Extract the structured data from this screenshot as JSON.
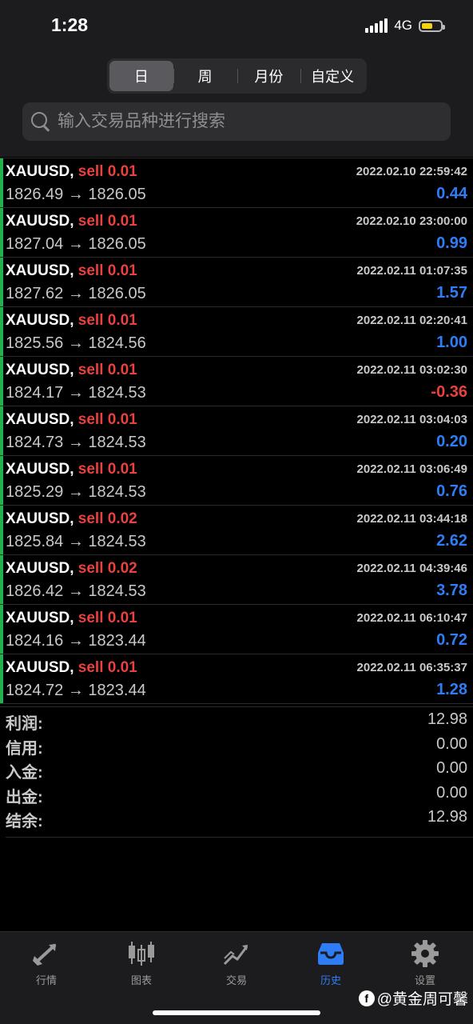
{
  "status_bar": {
    "time": "1:28",
    "network": "4G"
  },
  "period_tabs": [
    {
      "label": "日",
      "active": true
    },
    {
      "label": "周",
      "active": false
    },
    {
      "label": "月份",
      "active": false
    },
    {
      "label": "自定义",
      "active": false
    }
  ],
  "search": {
    "placeholder": "输入交易品种进行搜索"
  },
  "trades": [
    {
      "symbol": "XAUUSD,",
      "action": "sell 0.01",
      "time": "2022.02.10 22:59:42",
      "prices": "1826.49 → 1826.05",
      "profit": "0.44",
      "sign": "pos"
    },
    {
      "symbol": "XAUUSD,",
      "action": "sell 0.01",
      "time": "2022.02.10 23:00:00",
      "prices": "1827.04 → 1826.05",
      "profit": "0.99",
      "sign": "pos"
    },
    {
      "symbol": "XAUUSD,",
      "action": "sell 0.01",
      "time": "2022.02.11 01:07:35",
      "prices": "1827.62 → 1826.05",
      "profit": "1.57",
      "sign": "pos"
    },
    {
      "symbol": "XAUUSD,",
      "action": "sell 0.01",
      "time": "2022.02.11 02:20:41",
      "prices": "1825.56 → 1824.56",
      "profit": "1.00",
      "sign": "pos"
    },
    {
      "symbol": "XAUUSD,",
      "action": "sell 0.01",
      "time": "2022.02.11 03:02:30",
      "prices": "1824.17 → 1824.53",
      "profit": "-0.36",
      "sign": "neg"
    },
    {
      "symbol": "XAUUSD,",
      "action": "sell 0.01",
      "time": "2022.02.11 03:04:03",
      "prices": "1824.73 → 1824.53",
      "profit": "0.20",
      "sign": "pos"
    },
    {
      "symbol": "XAUUSD,",
      "action": "sell 0.01",
      "time": "2022.02.11 03:06:49",
      "prices": "1825.29 → 1824.53",
      "profit": "0.76",
      "sign": "pos"
    },
    {
      "symbol": "XAUUSD,",
      "action": "sell 0.02",
      "time": "2022.02.11 03:44:18",
      "prices": "1825.84 → 1824.53",
      "profit": "2.62",
      "sign": "pos"
    },
    {
      "symbol": "XAUUSD,",
      "action": "sell 0.02",
      "time": "2022.02.11 04:39:46",
      "prices": "1826.42 → 1824.53",
      "profit": "3.78",
      "sign": "pos"
    },
    {
      "symbol": "XAUUSD,",
      "action": "sell 0.01",
      "time": "2022.02.11 06:10:47",
      "prices": "1824.16 → 1823.44",
      "profit": "0.72",
      "sign": "pos"
    },
    {
      "symbol": "XAUUSD,",
      "action": "sell 0.01",
      "time": "2022.02.11 06:35:37",
      "prices": "1824.72 → 1823.44",
      "profit": "1.28",
      "sign": "pos"
    }
  ],
  "summary": [
    {
      "label": "利润:",
      "value": "12.98"
    },
    {
      "label": "信用:",
      "value": "0.00"
    },
    {
      "label": "入金:",
      "value": "0.00"
    },
    {
      "label": "出金:",
      "value": "0.00"
    },
    {
      "label": "结余:",
      "value": "12.98"
    }
  ],
  "tab_bar": [
    {
      "label": "行情",
      "icon": "quotes-icon",
      "active": false
    },
    {
      "label": "图表",
      "icon": "chart-icon",
      "active": false
    },
    {
      "label": "交易",
      "icon": "trade-icon",
      "active": false
    },
    {
      "label": "历史",
      "icon": "history-icon",
      "active": true
    },
    {
      "label": "设置",
      "icon": "settings-icon",
      "active": false
    }
  ],
  "watermark": {
    "text": "@黄金周可馨"
  },
  "colors": {
    "accent": "#2e7df6",
    "sell": "#e8413e",
    "row_marker": "#22b14c",
    "battery": "#f5d10a"
  }
}
